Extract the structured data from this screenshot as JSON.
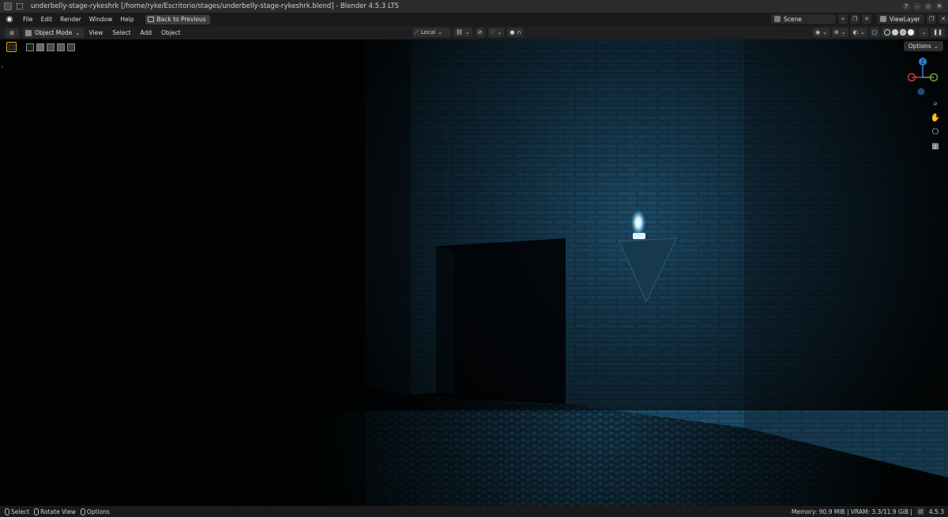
{
  "titlebar": {
    "title": "underbelly-stage-rykeshrk [/home/ryke/Escritorio/stages/underbelly-stage-rykeshrk.blend] - Blender 4.5.3 LTS",
    "buttons": [
      "?",
      "–",
      "◇",
      "✕"
    ]
  },
  "menubar": {
    "menus": [
      "File",
      "Edit",
      "Render",
      "Window",
      "Help"
    ],
    "back_button": "Back to Previous",
    "scene_label": "Scene",
    "viewlayer_label": "ViewLayer"
  },
  "header": {
    "editor_type_icon": "viewport-icon",
    "mode": "Object Mode",
    "menus": [
      "View",
      "Select",
      "Add",
      "Object"
    ],
    "transform_orientation": "Local"
  },
  "viewport": {
    "options_label": "Options",
    "gizmo_axis_label": "Z"
  },
  "statusbar": {
    "hints": [
      {
        "label": "Select"
      },
      {
        "label": "Rotate View"
      },
      {
        "label": "Options"
      }
    ],
    "memory": "Memory: 90.9 MiB | VRAM: 3.3/11.9 GiB |",
    "version": "4.5.3"
  },
  "colors": {
    "accent_active_tool": "#e0a020",
    "scene_blue": "#1b4a66",
    "axis_x": "#d23a3a",
    "axis_y": "#6aa83a",
    "axis_z": "#3a7ed2"
  }
}
